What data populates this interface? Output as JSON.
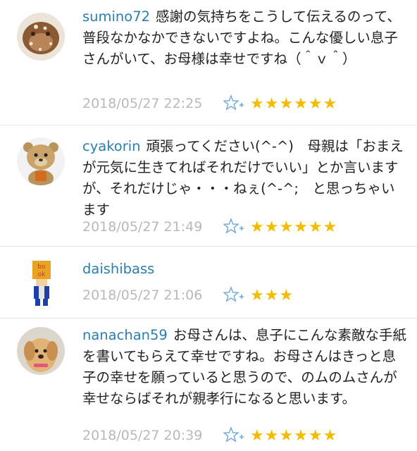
{
  "comments": [
    {
      "username": "sumino72",
      "text": "感謝の気持ちをこうして伝えるのって、普段なかなかできないですよね。こんな優しい息子さんがいて、お母様は幸せですね（＾ｖ＾）",
      "timestamp": "2018/05/27 22:25",
      "stars": "★★★★★★",
      "avatar_icon": "hamster-avatar-icon"
    },
    {
      "username": "cyakorin",
      "text": "頑張ってください(^-^)　母親は「おまえが元気に生きてればそれだけでいい」とか言いますが、それだけじゃ・・・ねぇ(^-^;　と思っちゃいます",
      "timestamp": "2018/05/27 21:49",
      "stars": "★★★★★★",
      "avatar_icon": "teddy-bear-avatar-icon"
    },
    {
      "username": "daishibass",
      "text": "",
      "timestamp": "2018/05/27 21:06",
      "stars": "★★★",
      "avatar_icon": "book-character-avatar-icon"
    },
    {
      "username": "nanachan59",
      "text": "お母さんは、息子にこんな素敵な手紙を書いてもらえて幸せですね。お母さんはきっと息子の幸せを願っていると思うので、のムのムさんが幸せならばそれが親孝行になると思います。",
      "timestamp": "2018/05/27 20:39",
      "stars": "★★★★★★",
      "avatar_icon": "puppy-avatar-icon"
    }
  ],
  "colors": {
    "username": "#2a7fb0",
    "star": "#f4bc00",
    "timestamp": "#b9b9b9",
    "favorite_icon": "#6fa8dc"
  }
}
